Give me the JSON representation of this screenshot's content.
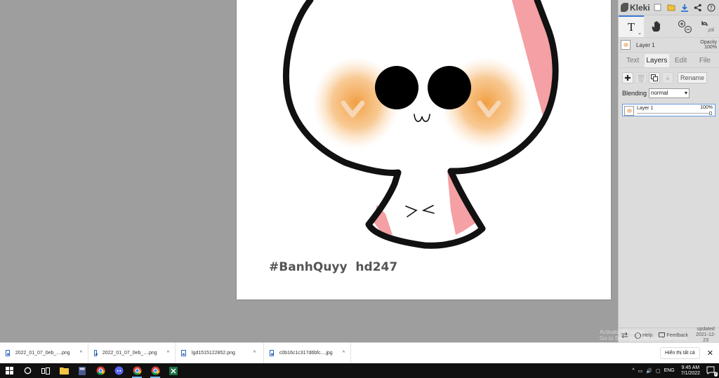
{
  "app": {
    "name": "Kleki"
  },
  "canvas": {
    "caption": "#BanhQuyy  hd247"
  },
  "panel": {
    "tabs": [
      {
        "label": "Text",
        "active": false
      },
      {
        "label": "Layers",
        "active": true
      },
      {
        "label": "Edit",
        "active": false
      },
      {
        "label": "File",
        "active": false
      }
    ],
    "current_layer": "Layer 1",
    "opacity_label": "Opacity",
    "opacity_value": "100%",
    "rename_label": "Rename",
    "blending_label": "Blending",
    "blending_value": "normal",
    "layer_item": {
      "name": "Layer 1",
      "opacity": "100%"
    },
    "help_label": "Help",
    "feedback_label": "Feedback",
    "updated_label": "updated",
    "updated_date": "2021-12-23"
  },
  "watermark": {
    "line1": "Activate Windows",
    "line2": "Go to Settings to activate Windows."
  },
  "downloads": {
    "items": [
      {
        "name": "2022_01_07_0eb_....png"
      },
      {
        "name": "2022_01_07_0eb_....png"
      },
      {
        "name": "lgd1515122852.png"
      },
      {
        "name": "c0b16c1c317d6bfc....jpg"
      }
    ],
    "show_all_label": "Hiển thị tất cả"
  },
  "taskbar": {
    "language": "ENG",
    "time": "9:45 AM",
    "date": "7/1/2022",
    "notification_count": "2"
  },
  "colors": {
    "workspace": "#9e9e9e",
    "blush": "#f0a040",
    "pink": "#f4a0a4",
    "accent": "#3d7bd5"
  }
}
